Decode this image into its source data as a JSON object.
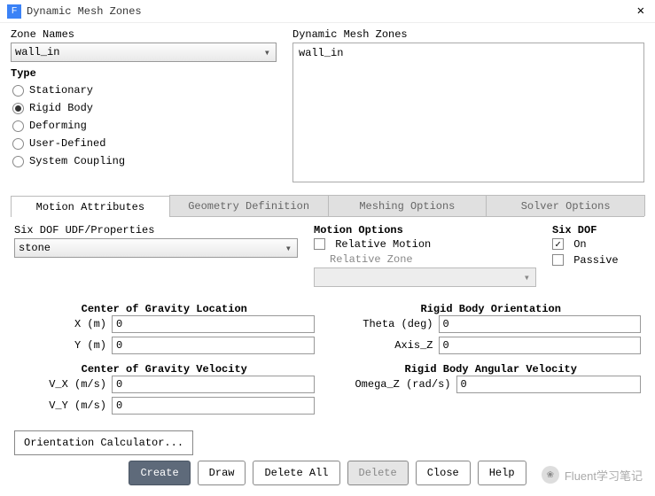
{
  "window": {
    "title": "Dynamic Mesh Zones",
    "icon_letter": "F"
  },
  "zone_names": {
    "label": "Zone Names",
    "value": "wall_in"
  },
  "zones_panel": {
    "label": "Dynamic Mesh Zones",
    "items": [
      "wall_in"
    ]
  },
  "type": {
    "label": "Type",
    "options": [
      {
        "label": "Stationary",
        "selected": false
      },
      {
        "label": "Rigid Body",
        "selected": true
      },
      {
        "label": "Deforming",
        "selected": false
      },
      {
        "label": "User-Defined",
        "selected": false
      },
      {
        "label": "System Coupling",
        "selected": false
      }
    ]
  },
  "tabs": {
    "items": [
      "Motion Attributes",
      "Geometry Definition",
      "Meshing Options",
      "Solver Options"
    ],
    "active": 0
  },
  "six_dof_udf": {
    "label": "Six DOF UDF/Properties",
    "value": "stone"
  },
  "motion_options": {
    "label": "Motion Options",
    "relative_motion": {
      "label": "Relative Motion",
      "checked": false
    },
    "relative_zone_label": "Relative Zone"
  },
  "six_dof": {
    "label": "Six DOF",
    "on": {
      "label": "On",
      "checked": true
    },
    "passive": {
      "label": "Passive",
      "checked": false
    }
  },
  "cog_loc": {
    "title": "Center of Gravity Location",
    "x": {
      "label": "X (m)",
      "value": "0"
    },
    "y": {
      "label": "Y (m)",
      "value": "0"
    }
  },
  "rb_orient": {
    "title": "Rigid Body Orientation",
    "theta": {
      "label": "Theta (deg)",
      "value": "0"
    },
    "axis_z": {
      "label": "Axis_Z",
      "value": "0"
    }
  },
  "cog_vel": {
    "title": "Center of Gravity Velocity",
    "vx": {
      "label": "V_X (m/s)",
      "value": "0"
    },
    "vy": {
      "label": "V_Y (m/s)",
      "value": "0"
    }
  },
  "rb_ang_vel": {
    "title": "Rigid Body Angular Velocity",
    "omega_z": {
      "label": "Omega_Z (rad/s)",
      "value": "0"
    }
  },
  "orientation_btn": "Orientation Calculator...",
  "buttons": {
    "create": "Create",
    "draw": "Draw",
    "delete_all": "Delete All",
    "delete": "Delete",
    "close": "Close",
    "help": "Help"
  },
  "watermark": "Fluent学习笔记"
}
